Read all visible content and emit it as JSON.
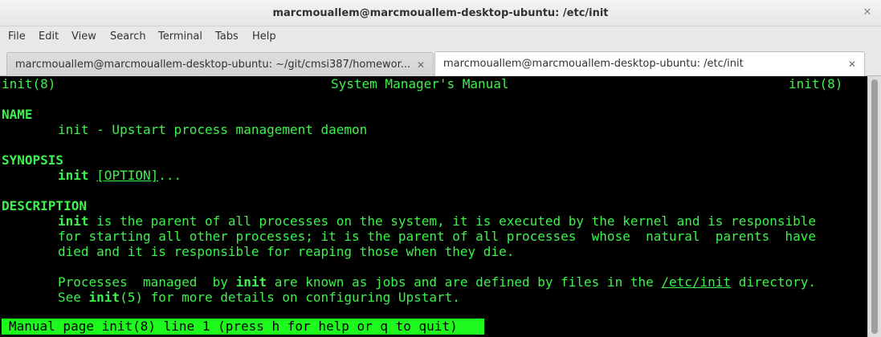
{
  "window": {
    "title": "marcmouallem@marcmouallem-desktop-ubuntu: /etc/init",
    "close_glyph": "✕"
  },
  "menubar": {
    "items": [
      "File",
      "Edit",
      "View",
      "Search",
      "Terminal",
      "Tabs",
      "Help"
    ]
  },
  "tabs": [
    {
      "label": "marcmouallem@marcmouallem-desktop-ubuntu: ~/git/cmsi387/homewor...",
      "close_glyph": "✕",
      "active": false
    },
    {
      "label": "marcmouallem@marcmouallem-desktop-ubuntu: /etc/init",
      "close_glyph": "✕",
      "active": true
    }
  ],
  "terminal": {
    "colors": {
      "background": "#000000",
      "foreground": "#3cf24c",
      "status_bg": "#1df81d"
    },
    "header": {
      "left": "init(8)",
      "center": "System Manager's Manual",
      "right": "init(8)"
    },
    "name_heading": "NAME",
    "name_line": "init - Upstart process management daemon",
    "synopsis_heading": "SYNOPSIS",
    "synopsis": {
      "cmd": "init",
      "option": "[OPTION]",
      "rest": "..."
    },
    "description_heading": "DESCRIPTION",
    "desc1": {
      "cmd": "init",
      "l1_rest": " is the parent of all processes on the system, it is executed by the kernel and is responsible",
      "l2": "for starting all other processes; it is the parent of all processes  whose  natural  parents  have",
      "l3": "died and it is responsible for reaping those when they die."
    },
    "desc2": {
      "l1_a": "Processes  managed  by ",
      "l1_cmd": "init",
      "l1_b": " are known as jobs and are defined by files in the ",
      "l1_path": "/etc/init",
      "l1_c": " directory.",
      "l2_a": "See ",
      "l2_cmd": "init",
      "l2_b": "(5) for more details on configuring Upstart."
    },
    "status_line": "Manual page init(8) line 1 (press h for help or q to quit)"
  }
}
